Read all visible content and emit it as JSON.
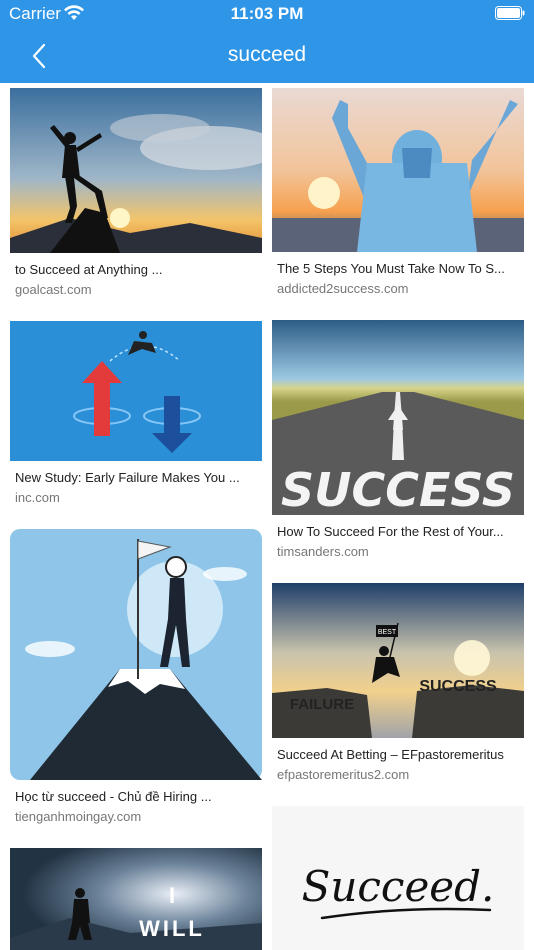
{
  "status_bar": {
    "carrier": "Carrier",
    "time": "11:03 PM"
  },
  "nav": {
    "title": "succeed"
  },
  "results": {
    "left": [
      {
        "title": "to Succeed at Anything ...",
        "source": "goalcast.com"
      },
      {
        "title": "New Study: Early Failure Makes You ...",
        "source": "inc.com"
      },
      {
        "title": "Học từ succeed - Chủ đề Hiring ...",
        "source": "tienganhmoingay.com"
      },
      {
        "title": "",
        "source": "",
        "image_text_line1": "I",
        "image_text_line2": "WILL"
      }
    ],
    "right": [
      {
        "title": "The 5 Steps You Must Take Now To S...",
        "source": "addicted2success.com"
      },
      {
        "title": "How To Succeed For the Rest of Your...",
        "source": "timsanders.com",
        "image_text": "SUCCESS"
      },
      {
        "title": "Succeed At Betting – EFpastoremeritus",
        "source": "efpastoremeritus2.com",
        "image_text_left": "FAILURE",
        "image_text_right": "SUCCESS",
        "flag_text": "BEST"
      },
      {
        "title": "",
        "source": "",
        "image_text": "Succeed."
      }
    ]
  },
  "colors": {
    "nav_bar": "#2f95e7",
    "title_text": "#222222",
    "source_text": "#777777"
  }
}
